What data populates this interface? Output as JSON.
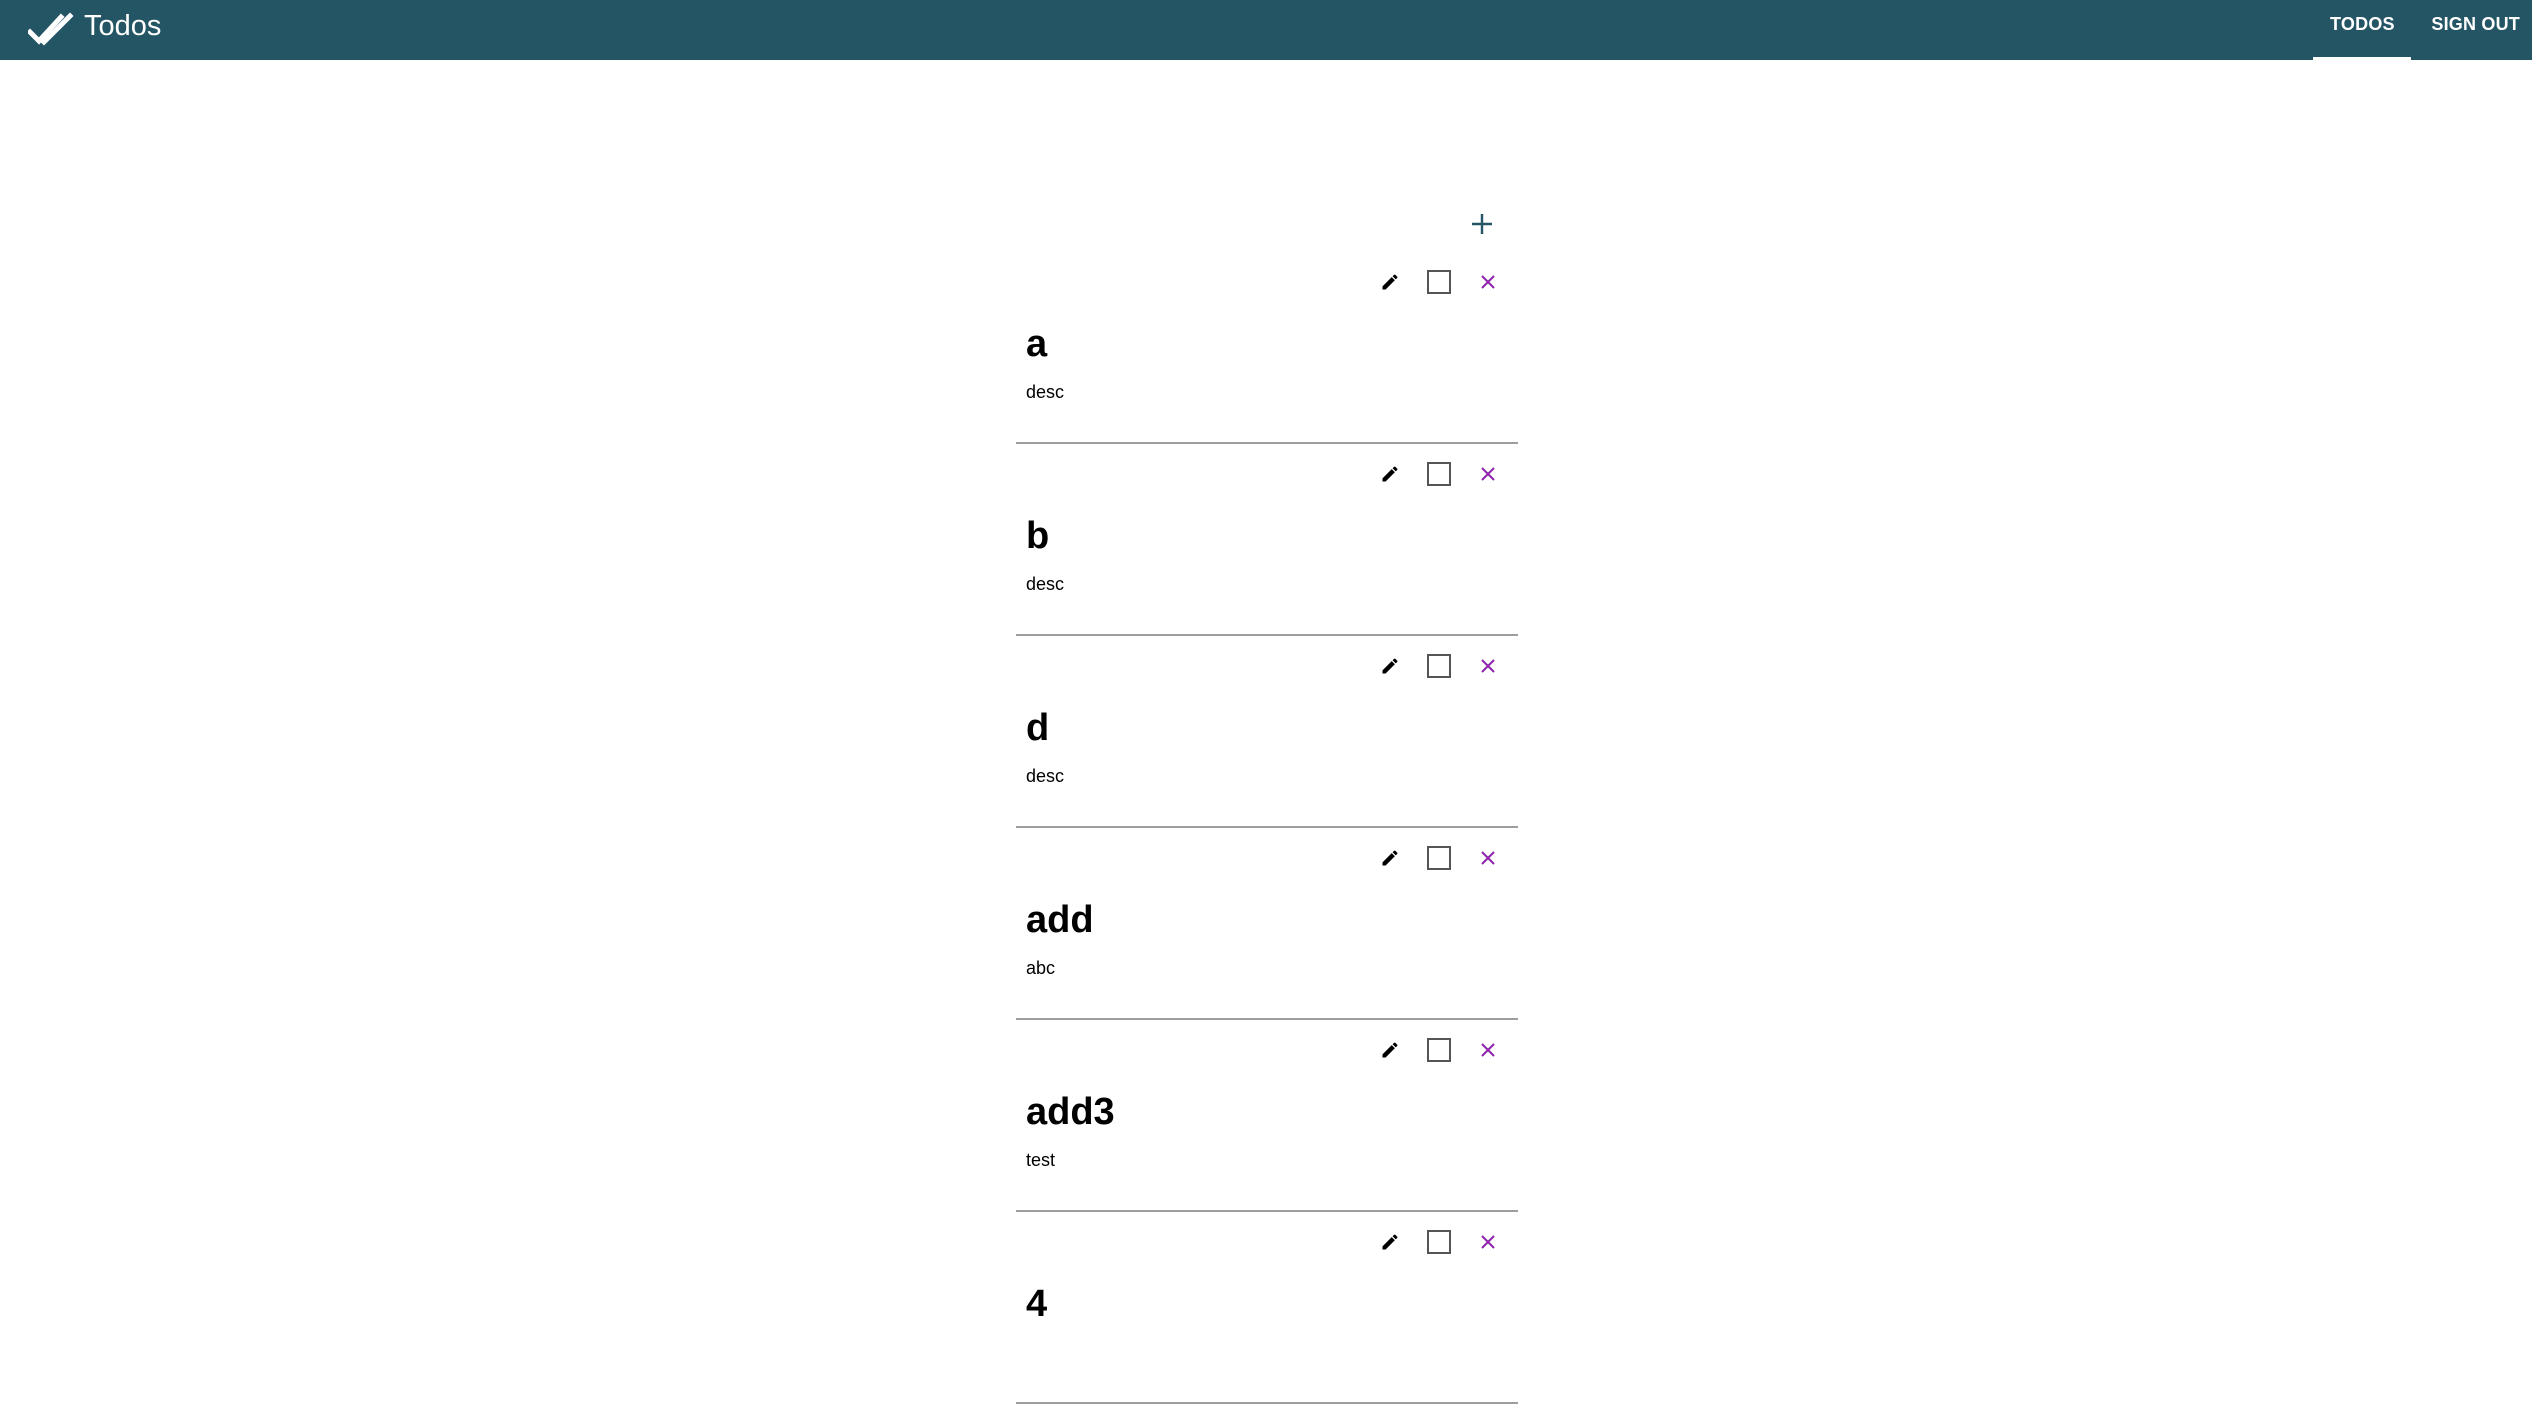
{
  "header": {
    "app_title": "Todos",
    "logo_icon": "double-check-icon",
    "nav": [
      {
        "label": "TODOS",
        "active": true
      },
      {
        "label": "SIGN OUT",
        "active": false
      }
    ],
    "bg_color": "#245564"
  },
  "add_button": {
    "icon": "plus-icon"
  },
  "todos": [
    {
      "title": "a",
      "description": "desc",
      "completed": false
    },
    {
      "title": "b",
      "description": "desc",
      "completed": false
    },
    {
      "title": "d",
      "description": "desc",
      "completed": false
    },
    {
      "title": "add",
      "description": "abc",
      "completed": false
    },
    {
      "title": "add3",
      "description": "test",
      "completed": false
    },
    {
      "title": "4",
      "description": "",
      "completed": false
    }
  ],
  "item_actions": {
    "edit_icon": "pencil-icon",
    "complete_icon": "checkbox-icon",
    "delete_icon": "close-icon",
    "delete_color": "#8e24aa"
  }
}
